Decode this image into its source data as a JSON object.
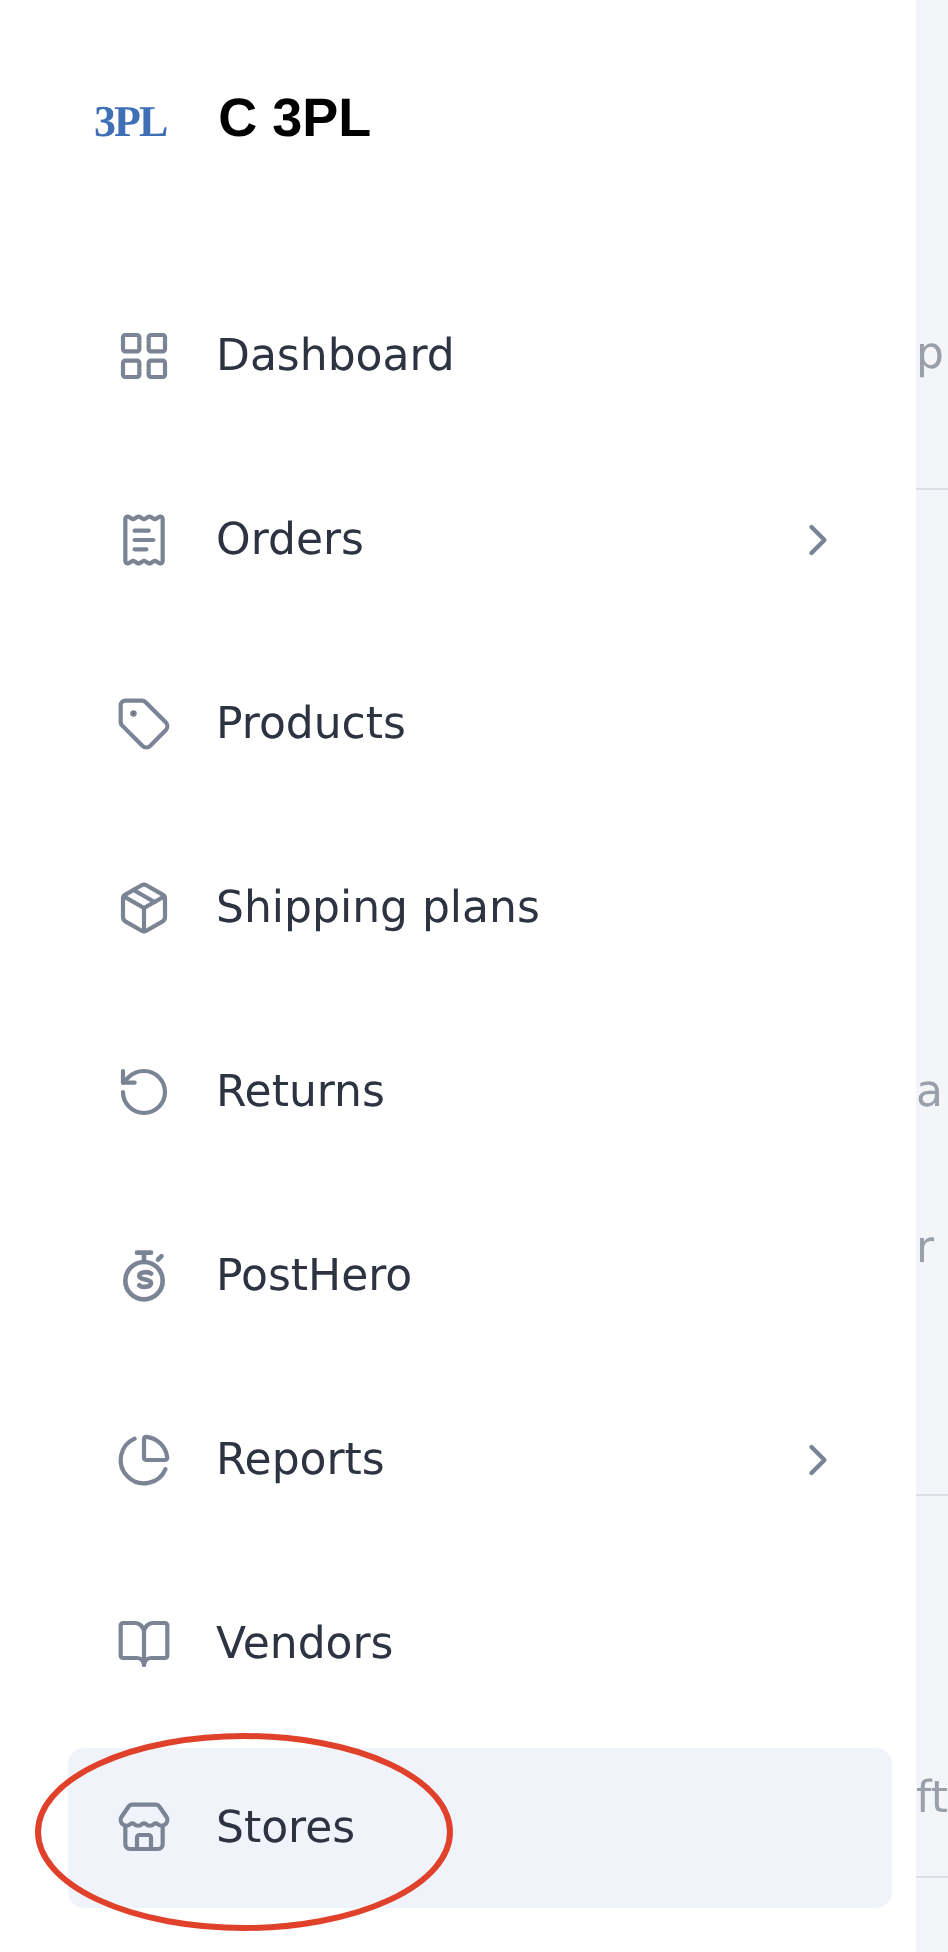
{
  "brand": {
    "logo_text": "3PL",
    "title": "C 3PL"
  },
  "nav": [
    {
      "label": "Dashboard",
      "has_submenu": false,
      "selected": false
    },
    {
      "label": "Orders",
      "has_submenu": true,
      "selected": false
    },
    {
      "label": "Products",
      "has_submenu": false,
      "selected": false
    },
    {
      "label": "Shipping plans",
      "has_submenu": false,
      "selected": false
    },
    {
      "label": "Returns",
      "has_submenu": false,
      "selected": false
    },
    {
      "label": "PostHero",
      "has_submenu": false,
      "selected": false
    },
    {
      "label": "Reports",
      "has_submenu": true,
      "selected": false
    },
    {
      "label": "Vendors",
      "has_submenu": false,
      "selected": false
    },
    {
      "label": "Stores",
      "has_submenu": false,
      "selected": true
    }
  ],
  "background_fragments": [
    "p",
    "a",
    "r",
    "ft"
  ]
}
